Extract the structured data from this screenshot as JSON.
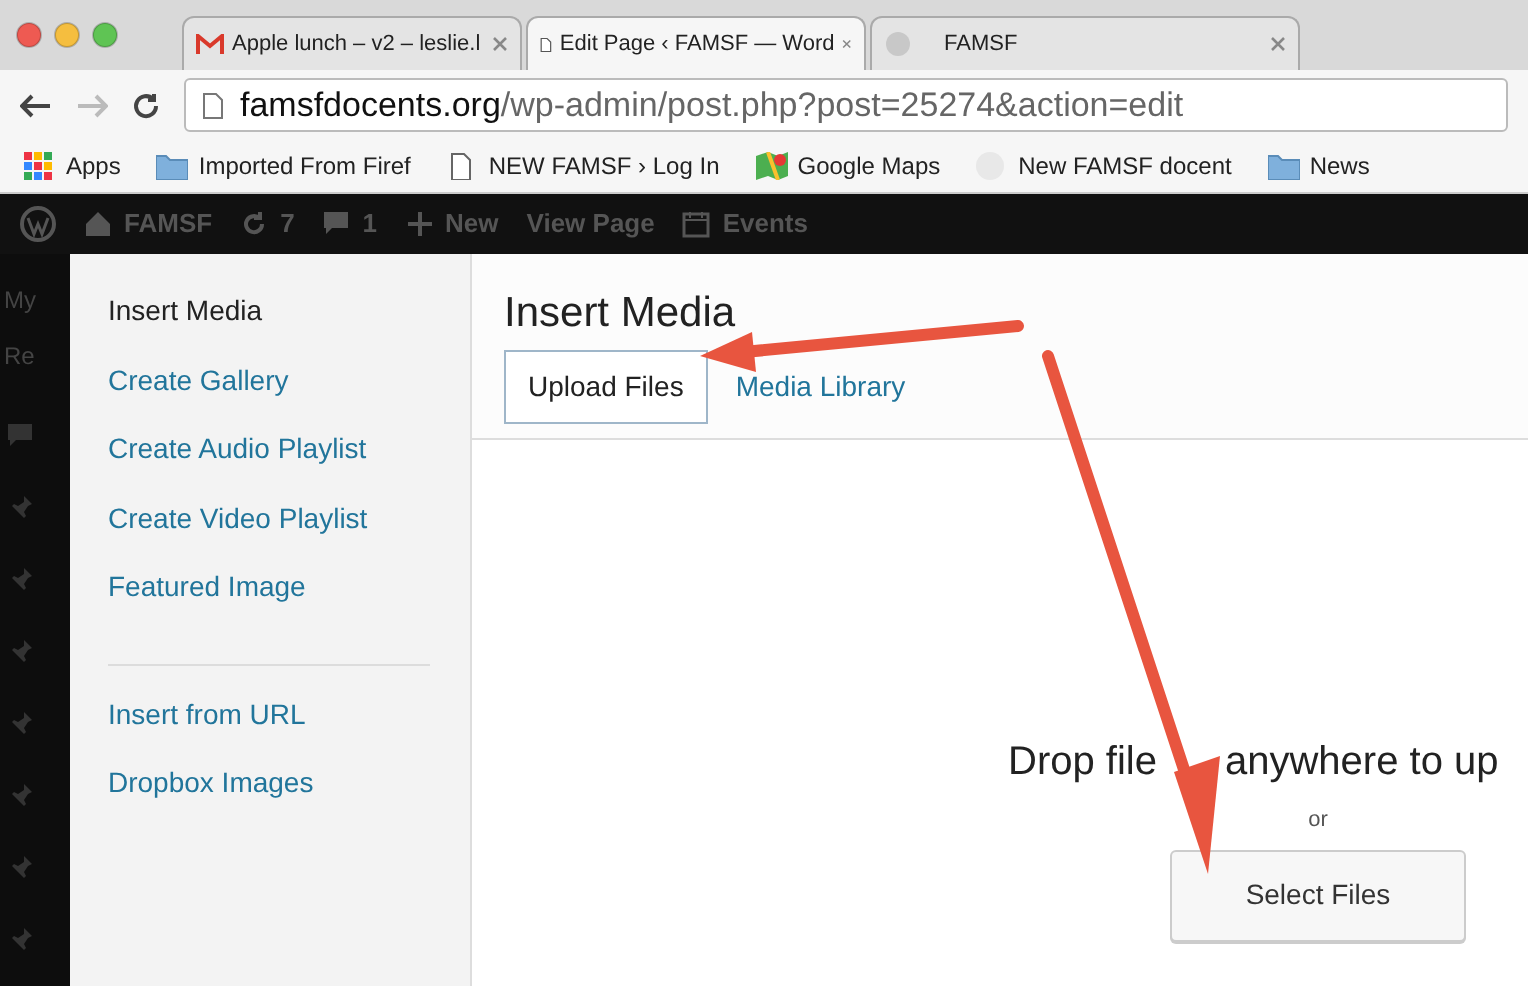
{
  "browser": {
    "tabs": [
      {
        "title": "Apple lunch – v2 – leslie.l",
        "kind": "mail",
        "selected": false
      },
      {
        "title": "Edit Page ‹ FAMSF — Word",
        "kind": "page",
        "selected": true
      },
      {
        "title": "FAMSF",
        "kind": "blank",
        "selected": false
      }
    ],
    "address": {
      "domain": "famsfdocents.org",
      "path": "/wp-admin/post.php?post=25274&action=edit"
    },
    "bookmarks": [
      {
        "label": "Apps",
        "kind": "apps"
      },
      {
        "label": "Imported From Firef",
        "kind": "folder"
      },
      {
        "label": "NEW FAMSF › Log In",
        "kind": "page"
      },
      {
        "label": "Google Maps",
        "kind": "map"
      },
      {
        "label": "New FAMSF docent",
        "kind": "blank"
      },
      {
        "label": "News",
        "kind": "folder"
      }
    ]
  },
  "admin_bar": {
    "items": [
      {
        "label": "FAMSF",
        "kind": "home"
      },
      {
        "label": "7",
        "kind": "updates"
      },
      {
        "label": "1",
        "kind": "comments"
      },
      {
        "label": "New",
        "kind": "new"
      },
      {
        "label": "View Page",
        "kind": "plain"
      },
      {
        "label": "Events",
        "kind": "calendar"
      }
    ],
    "side_texts": [
      "My",
      "Re"
    ]
  },
  "media_menu": {
    "items": [
      {
        "label": "Insert Media",
        "selected": true,
        "kind": "link"
      },
      {
        "label": "Create Gallery",
        "selected": false,
        "kind": "link"
      },
      {
        "label": "Create Audio Playlist",
        "selected": false,
        "kind": "link"
      },
      {
        "label": "Create Video Playlist",
        "selected": false,
        "kind": "link"
      },
      {
        "label": "Featured Image",
        "selected": false,
        "kind": "link"
      },
      {
        "kind": "separator"
      },
      {
        "label": "Insert from URL",
        "selected": false,
        "kind": "link"
      },
      {
        "label": "Dropbox Images",
        "selected": false,
        "kind": "link"
      }
    ]
  },
  "frame": {
    "title": "Insert Media",
    "tabs": [
      {
        "label": "Upload Files",
        "selected": true
      },
      {
        "label": "Media Library",
        "selected": false
      }
    ],
    "drop_texts": [
      "Drop file",
      "anywhere to up"
    ],
    "or_text": "or",
    "button": "Select Files"
  }
}
